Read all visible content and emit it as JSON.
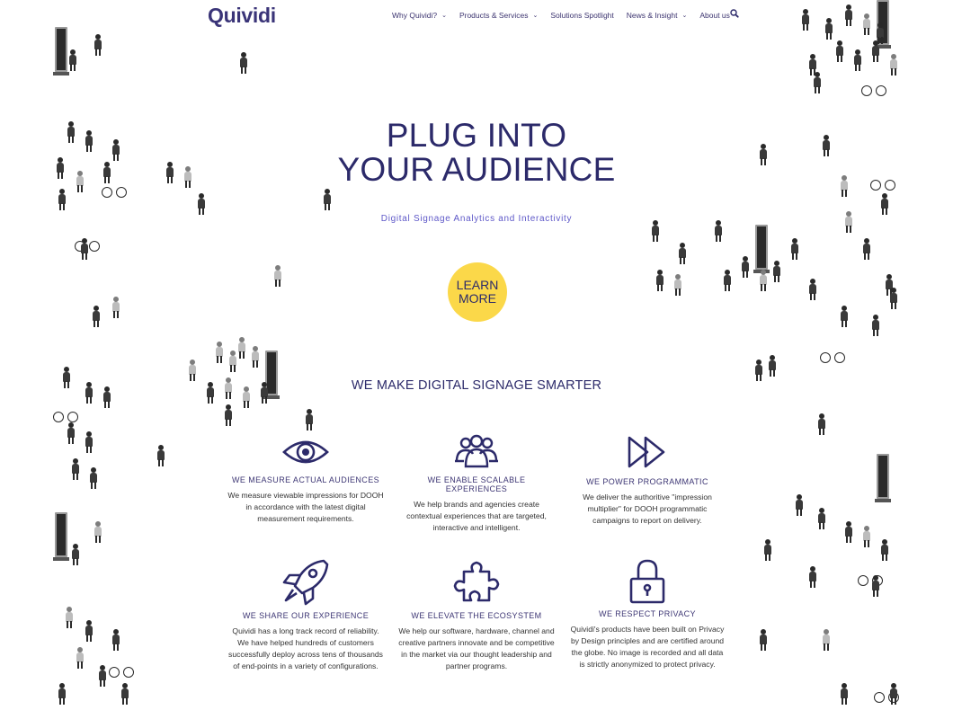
{
  "header": {
    "logo": "Quividi",
    "nav": [
      {
        "label": "Why Quividi?",
        "has_dropdown": true
      },
      {
        "label": "Products & Services",
        "has_dropdown": true
      },
      {
        "label": "Solutions Spotlight",
        "has_dropdown": false
      },
      {
        "label": "News & Insight",
        "has_dropdown": true
      },
      {
        "label": "About us",
        "has_dropdown": true
      }
    ],
    "search_icon": "search-icon"
  },
  "hero": {
    "title_line1": "PLUG INTO",
    "title_line2": "YOUR AUDIENCE",
    "subtitle": "Digital Signage Analytics and Interactivity",
    "cta_line1": "LEARN",
    "cta_line2": "MORE",
    "cta_color": "#fbd849"
  },
  "section_title": "WE MAKE DIGITAL SIGNAGE SMARTER",
  "features": [
    {
      "icon": "eye-icon",
      "title": "WE MEASURE ACTUAL AUDIENCES",
      "text": "We measure viewable impressions for DOOH in accordance with the latest digital measurement requirements."
    },
    {
      "icon": "people-group-icon",
      "title": "WE ENABLE SCALABLE EXPERIENCES",
      "text": "We help brands and agencies create contextual experiences that are targeted, interactive and intelligent."
    },
    {
      "icon": "fast-forward-icon",
      "title": "WE POWER PROGRAMMATIC",
      "text": "We deliver the authoritive \"impression multiplier\" for DOOH programmatic campaigns to report on delivery."
    },
    {
      "icon": "rocket-icon",
      "title": "WE SHARE OUR EXPERIENCE",
      "text": "Quividi has a long track record of reliability. We have helped hundreds of customers successfully deploy across tens of thousands of end-points in a variety of configurations."
    },
    {
      "icon": "puzzle-icon",
      "title": "WE ELEVATE THE ECOSYSTEM",
      "text": "We help our software, hardware, channel and creative partners innovate and be competitive in the market via our thought leadership and partner programs."
    },
    {
      "icon": "lock-icon",
      "title": "WE RESPECT PRIVACY",
      "text": "Quividi's products have been built on Privacy by Design principles and are certified around the globe. No image is recorded and all data is strictly anonymized to protect privacy."
    }
  ],
  "colors": {
    "brand": "#3a3478",
    "accent": "#5e58c8",
    "cta": "#fbd849"
  }
}
